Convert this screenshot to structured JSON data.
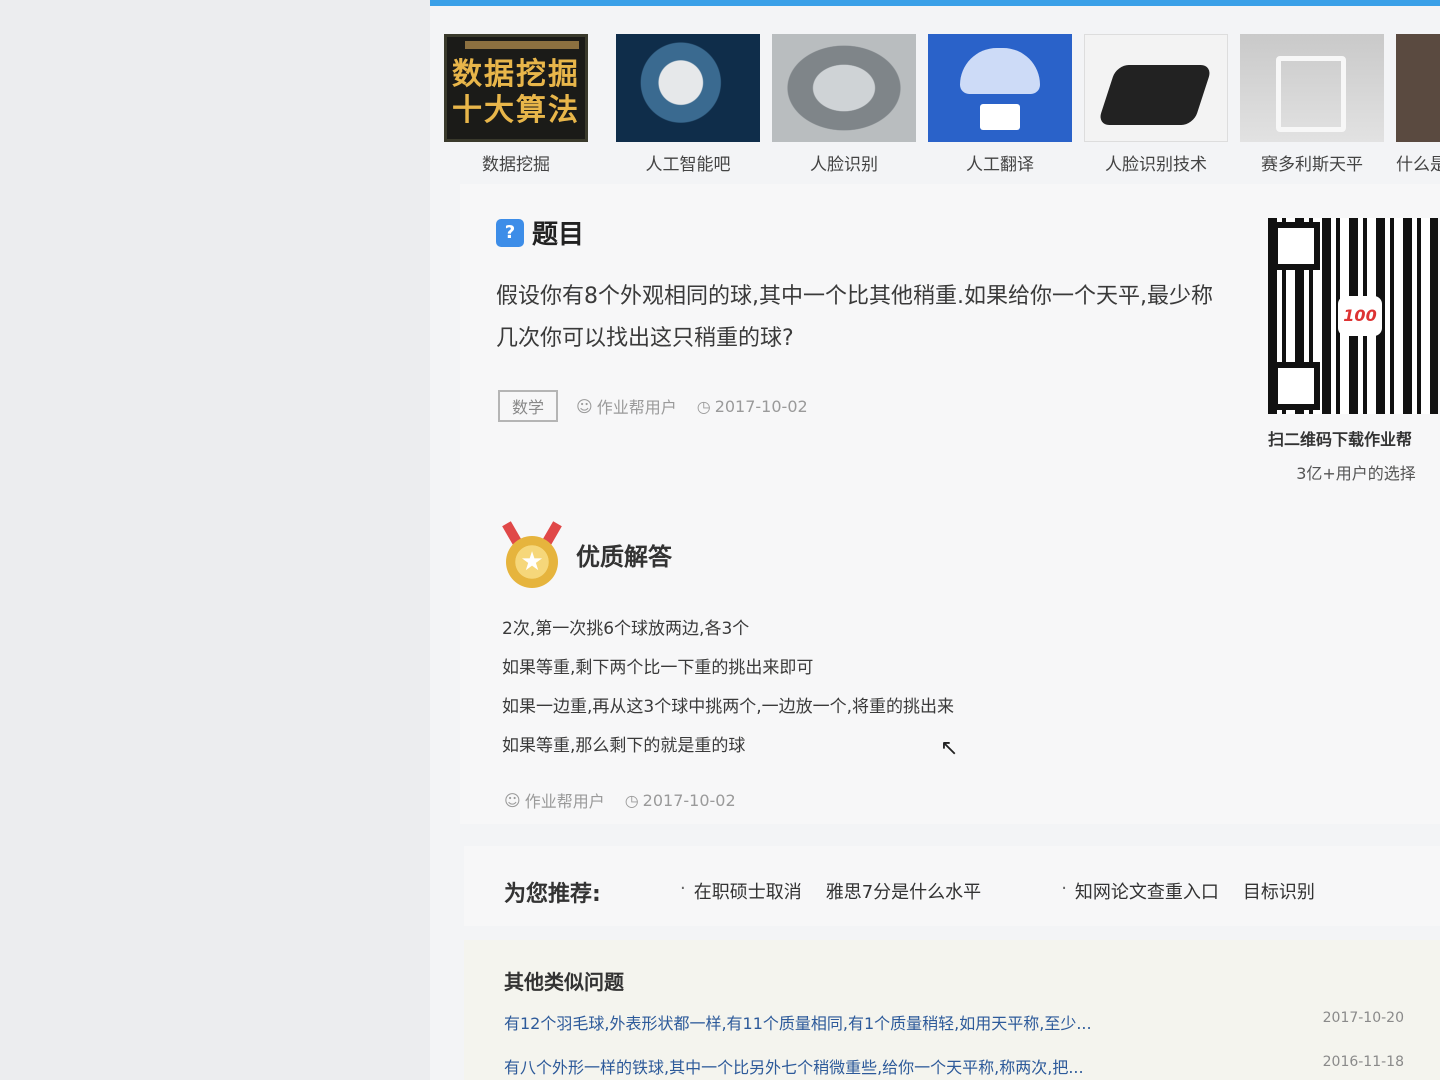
{
  "banner": [
    {
      "caption": "数据挖掘",
      "thumb_title_line1": "数据挖掘",
      "thumb_title_line2": "十大算法"
    },
    {
      "caption": "人工智能吧"
    },
    {
      "caption": "人脸识别"
    },
    {
      "caption": "人工翻译"
    },
    {
      "caption": "人脸识别技术"
    },
    {
      "caption": "赛多利斯天平"
    },
    {
      "caption": "什么是"
    }
  ],
  "question": {
    "section_title": "题目",
    "icon_char": "?",
    "text": "假设你有8个外观相同的球,其中一个比其他稍重.如果给你一个天平,最少称几次你可以找出这只稍重的球?",
    "tag": "数学",
    "user": "作业帮用户",
    "date": "2017-10-02"
  },
  "qr": {
    "logo_text": "100",
    "caption_main": "扫二维码下载作业帮",
    "caption_sub": "3亿+用户的选择"
  },
  "answer": {
    "section_title": "优质解答",
    "lines": [
      "2次,第一次挑6个球放两边,各3个",
      "如果等重,剩下两个比一下重的挑出来即可",
      "如果一边重,再从这3个球中挑两个,一边放一个,将重的挑出来",
      "如果等重,那么剩下的就是重的球"
    ],
    "user": "作业帮用户",
    "date": "2017-10-02"
  },
  "recommend": {
    "label": "为您推荐:",
    "items": [
      "在职硕士取消",
      "雅思7分是什么水平",
      "知网论文查重入口",
      "目标识别"
    ]
  },
  "similar": {
    "title": "其他类似问题",
    "rows": [
      {
        "text": "有12个羽毛球,外表形状都一样,有11个质量相同,有1个质量稍轻,如用天平称,至少...",
        "date": "2017-10-20"
      },
      {
        "text": "有八个外形一样的铁球,其中一个比另外七个稍微重些,给你一个天平称,称两次,把...",
        "date": "2016-11-18"
      }
    ]
  },
  "icons": {
    "user": "user-icon",
    "clock": "clock-icon",
    "medal": "medal-icon",
    "cursor": "mouse-cursor-icon"
  },
  "colors": {
    "accent": "#3d8de8",
    "link": "#2d5a9a",
    "medal_gold": "#e6b43d",
    "ribbon_red": "#e04848"
  }
}
